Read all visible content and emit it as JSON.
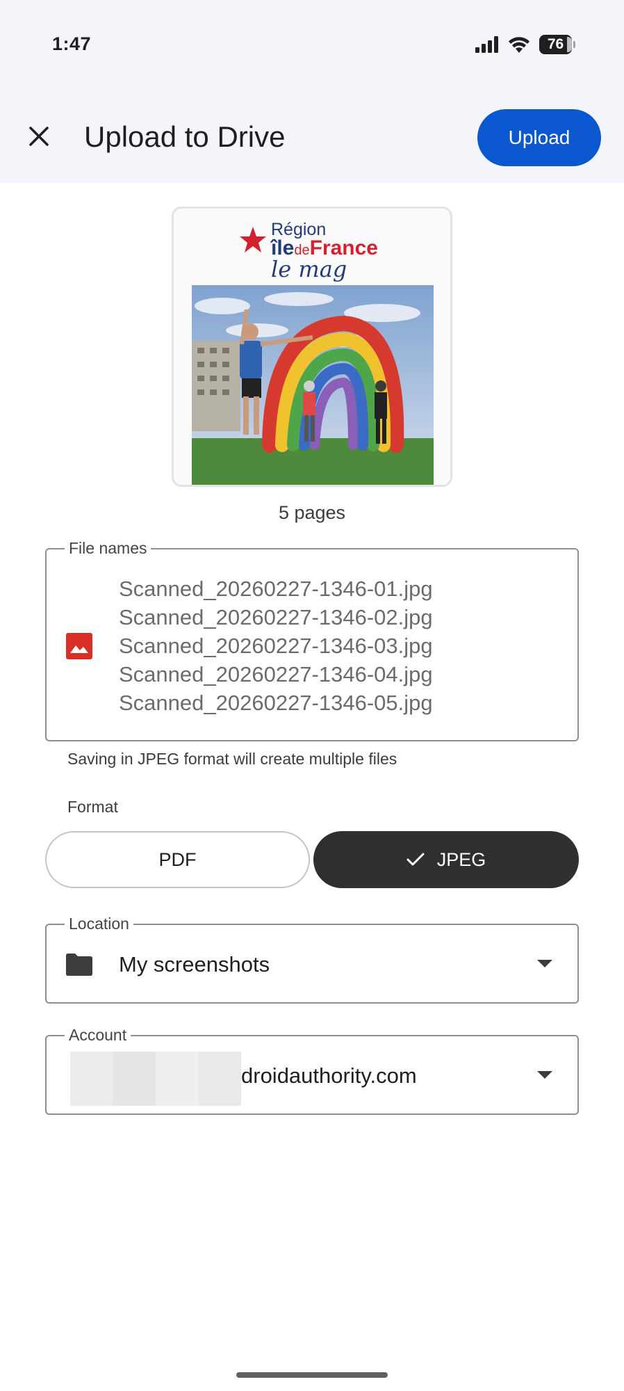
{
  "status_bar": {
    "time": "1:47",
    "battery": "76"
  },
  "header": {
    "title": "Upload to Drive",
    "upload_label": "Upload"
  },
  "preview": {
    "cover_line1": "Région",
    "cover_line2_a": "île",
    "cover_line2_b": "de",
    "cover_line2_c": "France",
    "cover_line3": "le mag",
    "pages_label": "5 pages"
  },
  "files": {
    "label": "File names",
    "names": [
      "Scanned_20260227-1346-01.jpg",
      "Scanned_20260227-1346-02.jpg",
      "Scanned_20260227-1346-03.jpg",
      "Scanned_20260227-1346-04.jpg",
      "Scanned_20260227-1346-05.jpg"
    ],
    "note": "Saving in JPEG format will create multiple files"
  },
  "format": {
    "label": "Format",
    "options": [
      "PDF",
      "JPEG"
    ],
    "selected": "JPEG"
  },
  "location": {
    "label": "Location",
    "value": "My screenshots"
  },
  "account": {
    "label": "Account",
    "value_visible": "droidauthority.com"
  },
  "colors": {
    "accent": "#0b57d0",
    "selected_segment": "#2f2f2f",
    "header_bg": "#f3f5fa",
    "file_icon": "#d93025"
  }
}
